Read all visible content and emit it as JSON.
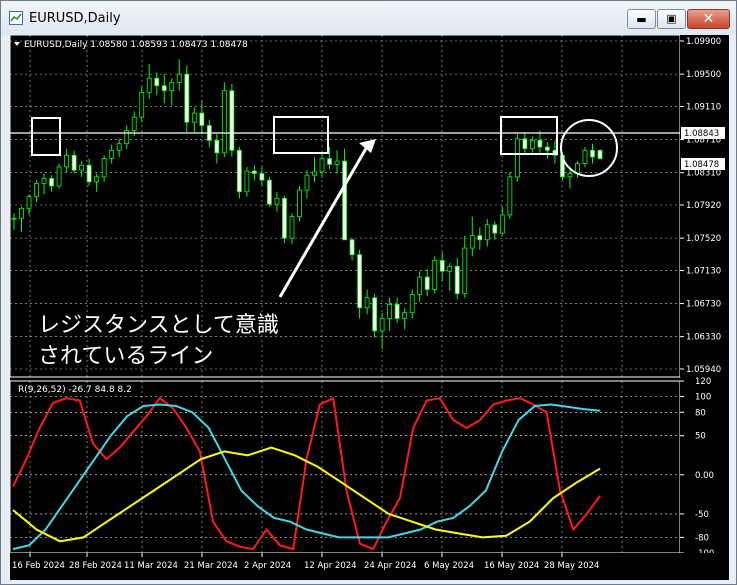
{
  "window": {
    "title": "EURUSD,Daily",
    "minimize_icon": "minimize-icon",
    "restore_icon": "restore-icon",
    "close_icon": "close-icon"
  },
  "price_panel": {
    "header": "EURUSD,Daily  1.08580 1.08593 1.08473 1.08478",
    "price_scale": [
      "1.09900",
      "1.09500",
      "1.09110",
      "1.08710",
      "1.08310",
      "1.07920",
      "1.07520",
      "1.07130",
      "1.06730",
      "1.06330",
      "1.05940"
    ],
    "resistance_label": "1.08843",
    "current_label": "1.08478",
    "annotation_line1": "レジスタンスとして意識",
    "annotation_line2": "されているライン"
  },
  "indicator_panel": {
    "header": "R(9,26,52) -26.7 84.8 8.2",
    "scale": [
      "120",
      "100",
      "80",
      "50",
      "0.00",
      "-50",
      "-80",
      "-100"
    ]
  },
  "time_axis": [
    "16 Feb 2024",
    "28 Feb 2024",
    "11 Mar 2024",
    "21 Mar 2024",
    "2 Apr 2024",
    "12 Apr 2024",
    "24 Apr 2024",
    "6 May 2024",
    "16 May 2024",
    "28 May 2024"
  ],
  "colors": {
    "bull": "#000000",
    "bear": "#ffffff",
    "outline": "#00ff00",
    "grid": "#c8c8c8",
    "r_fast": "#ff1a1a",
    "r_mid": "#3fd8e8",
    "r_slow": "#ffff00",
    "levels": "#ffffff"
  },
  "chart_data": {
    "type": "candlestick",
    "symbol": "EURUSD",
    "timeframe": "Daily",
    "ylim": [
      1.0594,
      1.099
    ],
    "resistance": 1.08843,
    "last_price": 1.08478,
    "candles": [
      [
        1.0775,
        1.0782,
        1.0762,
        1.0776
      ],
      [
        1.0776,
        1.079,
        1.076,
        1.0788
      ],
      [
        1.0788,
        1.0805,
        1.078,
        1.0802
      ],
      [
        1.0802,
        1.0822,
        1.0795,
        1.0818
      ],
      [
        1.0818,
        1.083,
        1.0805,
        1.0824
      ],
      [
        1.0824,
        1.0828,
        1.0808,
        1.0815
      ],
      [
        1.0815,
        1.0842,
        1.0812,
        1.0838
      ],
      [
        1.0838,
        1.086,
        1.0832,
        1.0852
      ],
      [
        1.0852,
        1.0858,
        1.083,
        1.0834
      ],
      [
        1.0834,
        1.0845,
        1.0826,
        1.084
      ],
      [
        1.084,
        1.0848,
        1.0815,
        1.082
      ],
      [
        1.082,
        1.083,
        1.0808,
        1.0826
      ],
      [
        1.0826,
        1.0852,
        1.082,
        1.0848
      ],
      [
        1.0848,
        1.0865,
        1.0842,
        1.0858
      ],
      [
        1.0858,
        1.0872,
        1.085,
        1.0866
      ],
      [
        1.0866,
        1.0888,
        1.086,
        1.0882
      ],
      [
        1.0882,
        1.0905,
        1.0875,
        1.0898
      ],
      [
        1.0898,
        1.0935,
        1.0892,
        1.0928
      ],
      [
        1.0928,
        1.0962,
        1.092,
        1.0945
      ],
      [
        1.0945,
        1.0952,
        1.0925,
        1.0936
      ],
      [
        1.0936,
        1.095,
        1.0915,
        1.093
      ],
      [
        1.093,
        1.0945,
        1.0912,
        1.094
      ],
      [
        1.094,
        1.0968,
        1.093,
        1.095
      ],
      [
        1.095,
        1.096,
        1.088,
        1.0892
      ],
      [
        1.0892,
        1.091,
        1.088,
        1.0903
      ],
      [
        1.0903,
        1.0918,
        1.0878,
        1.0888
      ],
      [
        1.0888,
        1.0895,
        1.0862,
        1.087
      ],
      [
        1.087,
        1.0878,
        1.0842,
        1.0855
      ],
      [
        1.0855,
        1.094,
        1.085,
        1.093
      ],
      [
        1.093,
        1.0938,
        1.085,
        1.0858
      ],
      [
        1.0858,
        1.0862,
        1.08,
        1.0808
      ],
      [
        1.0808,
        1.0838,
        1.0802,
        1.0833
      ],
      [
        1.0833,
        1.084,
        1.0822,
        1.083
      ],
      [
        1.083,
        1.0838,
        1.0815,
        1.0822
      ],
      [
        1.0822,
        1.0826,
        1.079,
        1.0793
      ],
      [
        1.0793,
        1.0808,
        1.0784,
        1.08
      ],
      [
        1.08,
        1.0803,
        1.0746,
        1.0752
      ],
      [
        1.0752,
        1.0782,
        1.0745,
        1.0778
      ],
      [
        1.0778,
        1.0815,
        1.0772,
        1.081
      ],
      [
        1.081,
        1.0834,
        1.08,
        1.0828
      ],
      [
        1.0828,
        1.085,
        1.082,
        1.0832
      ],
      [
        1.0832,
        1.0855,
        1.0825,
        1.0848
      ],
      [
        1.0848,
        1.0862,
        1.0835,
        1.0841
      ],
      [
        1.0841,
        1.0858,
        1.083,
        1.0845
      ],
      [
        1.0845,
        1.086,
        1.0828,
        1.075
      ],
      [
        1.075,
        1.0752,
        1.0725,
        1.0732
      ],
      [
        1.0732,
        1.0738,
        1.0655,
        1.0668
      ],
      [
        1.0668,
        1.069,
        1.066,
        1.068
      ],
      [
        1.068,
        1.0685,
        1.0632,
        1.064
      ],
      [
        1.064,
        1.0662,
        1.0618,
        1.0655
      ],
      [
        1.0655,
        1.068,
        1.064,
        1.0672
      ],
      [
        1.0672,
        1.068,
        1.065,
        1.0655
      ],
      [
        1.0655,
        1.0668,
        1.0642,
        1.0662
      ],
      [
        1.0662,
        1.069,
        1.0655,
        1.0684
      ],
      [
        1.0684,
        1.0712,
        1.0675,
        1.0705
      ],
      [
        1.0705,
        1.0715,
        1.0682,
        1.069
      ],
      [
        1.069,
        1.073,
        1.0685,
        1.0725
      ],
      [
        1.0725,
        1.0735,
        1.07,
        1.0712
      ],
      [
        1.0712,
        1.0722,
        1.0688,
        1.0718
      ],
      [
        1.0718,
        1.0728,
        1.0678,
        1.0685
      ],
      [
        1.0685,
        1.0755,
        1.068,
        1.074
      ],
      [
        1.074,
        1.0778,
        1.073,
        1.0755
      ],
      [
        1.0755,
        1.0765,
        1.0738,
        1.075
      ],
      [
        1.075,
        1.0775,
        1.0742,
        1.0768
      ],
      [
        1.0768,
        1.0772,
        1.075,
        1.0758
      ],
      [
        1.0758,
        1.079,
        1.0755,
        1.078
      ],
      [
        1.078,
        1.0832,
        1.0775,
        1.0826
      ],
      [
        1.0826,
        1.0878,
        1.082,
        1.0872
      ],
      [
        1.0872,
        1.088,
        1.0852,
        1.086
      ],
      [
        1.086,
        1.0875,
        1.0855,
        1.087
      ],
      [
        1.087,
        1.0882,
        1.0855,
        1.0862
      ],
      [
        1.0862,
        1.0868,
        1.0848,
        1.0858
      ],
      [
        1.0858,
        1.087,
        1.0842,
        1.0852
      ],
      [
        1.0852,
        1.0856,
        1.0822,
        1.0826
      ],
      [
        1.0826,
        1.0838,
        1.0812,
        1.083
      ],
      [
        1.083,
        1.0845,
        1.0825,
        1.0842
      ],
      [
        1.0842,
        1.0862,
        1.0838,
        1.0858
      ],
      [
        1.0858,
        1.0866,
        1.0842,
        1.085
      ],
      [
        1.0858,
        1.0859,
        1.0847,
        1.0848
      ]
    ],
    "indicator": {
      "name": "R(9,26,52)",
      "levels": [
        100,
        80,
        50,
        0,
        -50,
        -80,
        -100
      ],
      "ylim": [
        -100,
        120
      ],
      "series": [
        {
          "name": "9",
          "values": [
            -15,
            20,
            60,
            92,
            98,
            95,
            40,
            20,
            35,
            55,
            75,
            98,
            85,
            60,
            30,
            -60,
            -85,
            -92,
            -95,
            -70,
            -90,
            -95,
            20,
            90,
            98,
            -20,
            -88,
            -95,
            -60,
            -30,
            60,
            95,
            98,
            70,
            60,
            70,
            90,
            95,
            98,
            90,
            80,
            -20,
            -70,
            -50,
            -27
          ]
        },
        {
          "name": "26",
          "values": [
            -95,
            -90,
            -70,
            -40,
            -10,
            20,
            50,
            75,
            88,
            90,
            88,
            80,
            60,
            20,
            -20,
            -40,
            -55,
            -60,
            -70,
            -75,
            -80,
            -80,
            -80,
            -80,
            -75,
            -70,
            -60,
            -55,
            -40,
            -20,
            30,
            70,
            88,
            90,
            87,
            84,
            82
          ]
        },
        {
          "name": "52",
          "values": [
            -45,
            -70,
            -85,
            -80,
            -60,
            -40,
            -20,
            0,
            20,
            30,
            25,
            35,
            25,
            10,
            -10,
            -30,
            -50,
            -60,
            -70,
            -75,
            -80,
            -78,
            -60,
            -30,
            -10,
            8
          ]
        }
      ]
    }
  }
}
